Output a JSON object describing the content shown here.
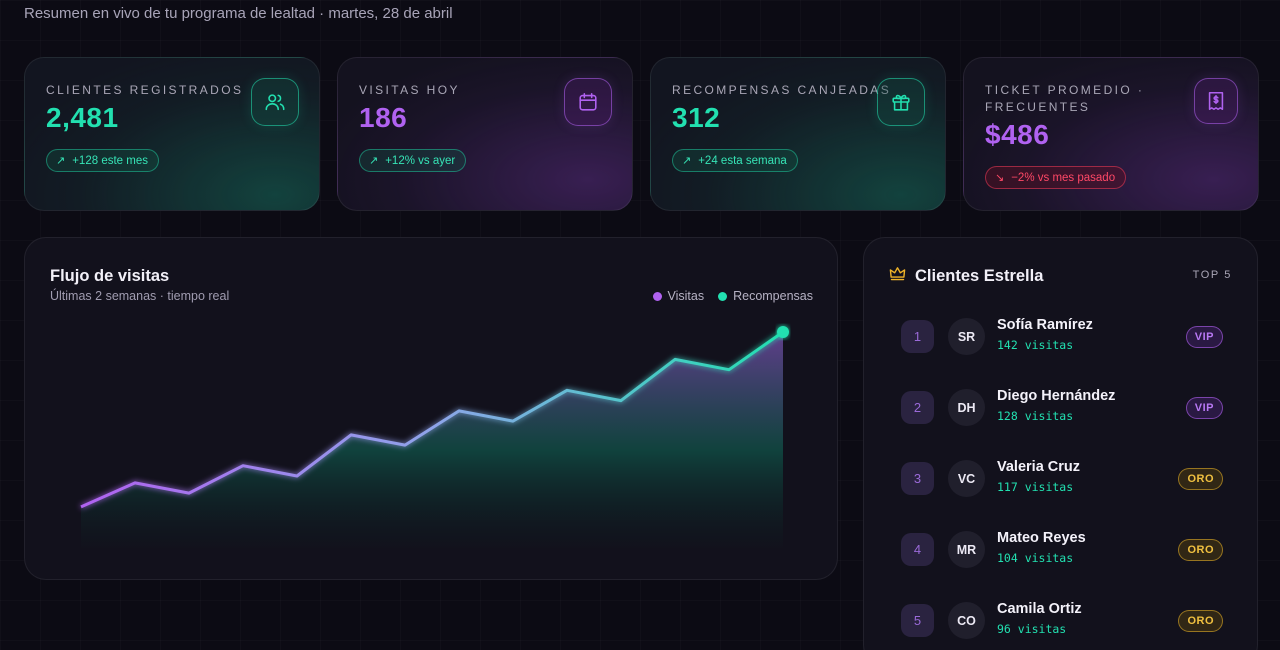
{
  "header": {
    "subtitle": "Resumen en vivo de tu programa de lealtad · martes, 28 de abril"
  },
  "kpis": [
    {
      "label": "CLIENTES REGISTRADOS",
      "value": "2,481",
      "badge": "+128 este mes",
      "arrow": "↗",
      "icon": "users-icon",
      "theme": "green"
    },
    {
      "label": "VISITAS HOY",
      "value": "186",
      "badge": "+12% vs ayer",
      "arrow": "↗",
      "icon": "calendar-icon",
      "theme": "purple"
    },
    {
      "label": "RECOMPENSAS CANJEADAS",
      "value": "312",
      "badge": "+24 esta semana",
      "arrow": "↗",
      "icon": "gift-icon",
      "theme": "green"
    },
    {
      "label_line1": "TICKET PROMEDIO ·",
      "label_line2": "FRECUENTES",
      "value": "$486",
      "badge": "−2% vs mes pasado",
      "arrow": "↘",
      "icon": "receipt-icon",
      "theme": "purple"
    }
  ],
  "chart_panel": {
    "title": "Flujo de visitas",
    "subtitle": "Últimas 2 semanas · tiempo real",
    "legend": [
      {
        "name": "Visitas",
        "color": "#b062f0"
      },
      {
        "name": "Recompensas",
        "color": "#22e0b0"
      }
    ]
  },
  "chart_data": {
    "type": "area",
    "series_line": [
      12,
      19,
      16,
      24,
      21,
      33,
      30,
      40,
      37,
      46,
      43,
      55,
      52,
      63
    ],
    "ylim": [
      0,
      70
    ],
    "gradient_from": "#b062f0",
    "gradient_to": "#22e0b0",
    "grid": false
  },
  "stars": {
    "title": "Clientes Estrella",
    "top_label": "TOP 5",
    "clients": [
      {
        "rank": "1",
        "initials": "SR",
        "name": "Sofía Ramírez",
        "visits": "142 visitas",
        "tier": "VIP"
      },
      {
        "rank": "2",
        "initials": "DH",
        "name": "Diego Hernández",
        "visits": "128 visitas",
        "tier": "VIP"
      },
      {
        "rank": "3",
        "initials": "VC",
        "name": "Valeria Cruz",
        "visits": "117 visitas",
        "tier": "ORO"
      },
      {
        "rank": "4",
        "initials": "MR",
        "name": "Mateo Reyes",
        "visits": "104 visitas",
        "tier": "ORO"
      },
      {
        "rank": "5",
        "initials": "CO",
        "name": "Camila Ortiz",
        "visits": "96 visitas",
        "tier": "ORO"
      }
    ]
  }
}
